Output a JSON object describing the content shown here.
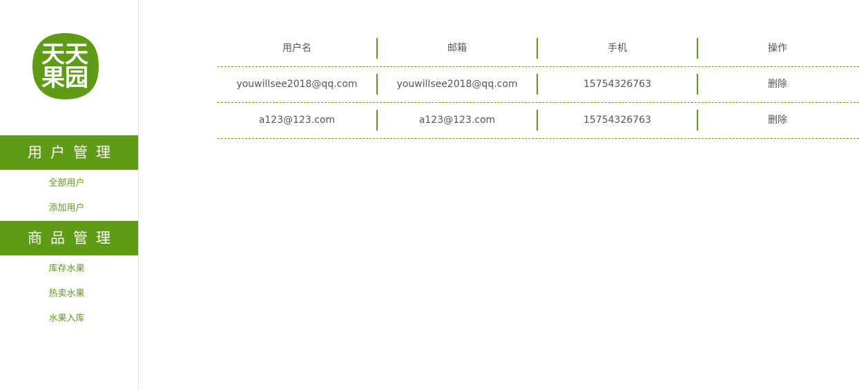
{
  "logo": {
    "text_line1": "天天",
    "text_line2": "果园",
    "color": "#5f9c16"
  },
  "sidebar": {
    "sections": [
      {
        "title": "用户管理",
        "items": [
          "全部用户",
          "添加用户"
        ]
      },
      {
        "title": "商品管理",
        "items": [
          "库存水果",
          "热卖水果",
          "水果入库"
        ]
      }
    ]
  },
  "table": {
    "headers": [
      "用户名",
      "邮箱",
      "手机",
      "操作"
    ],
    "rows": [
      [
        "youwillsee2018@qq.com",
        "youwillsee2018@qq.com",
        "15754326763",
        "删除"
      ],
      [
        "a123@123.com",
        "a123@123.com",
        "15754326763",
        "删除"
      ]
    ]
  },
  "colors": {
    "accent": "#5f9c16",
    "text": "#555555"
  }
}
